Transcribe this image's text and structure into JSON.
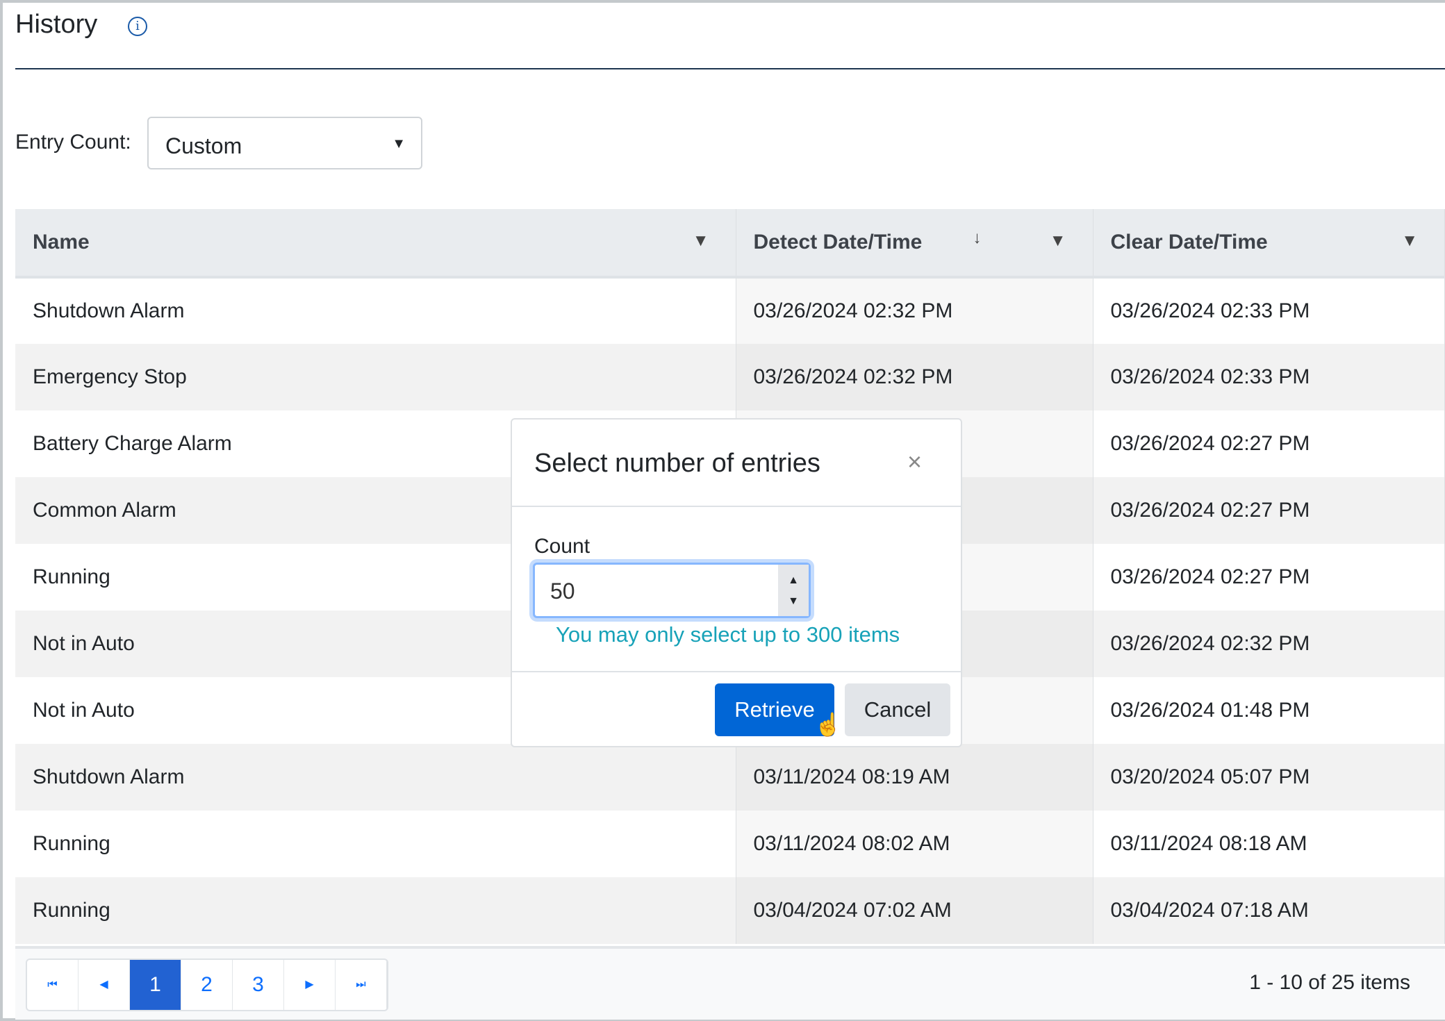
{
  "header": {
    "title": "History",
    "info_icon": "info-circle-icon"
  },
  "entry_count": {
    "label": "Entry Count:",
    "selected": "Custom"
  },
  "table": {
    "columns": [
      "Name",
      "Detect Date/Time",
      "Clear Date/Time"
    ],
    "sorted_column": "Detect Date/Time",
    "sort_direction": "descending",
    "rows": [
      [
        "Shutdown Alarm",
        "03/26/2024 02:32 PM",
        "03/26/2024 02:33 PM"
      ],
      [
        "Emergency Stop",
        "03/26/2024 02:32 PM",
        "03/26/2024 02:33 PM"
      ],
      [
        "Battery Charge Alarm",
        "",
        "03/26/2024 02:27 PM"
      ],
      [
        "Common Alarm",
        "",
        "03/26/2024 02:27 PM"
      ],
      [
        "Running",
        "",
        "03/26/2024 02:27 PM"
      ],
      [
        "Not in Auto",
        "",
        "03/26/2024 02:32 PM"
      ],
      [
        "Not in Auto",
        "",
        "03/26/2024 01:48 PM"
      ],
      [
        "Shutdown Alarm",
        "03/11/2024 08:19 AM",
        "03/20/2024 05:07 PM"
      ],
      [
        "Running",
        "03/11/2024 08:02 AM",
        "03/11/2024 08:18 AM"
      ],
      [
        "Running",
        "03/04/2024 07:02 AM",
        "03/04/2024 07:18 AM"
      ]
    ]
  },
  "pager": {
    "pages": [
      "1",
      "2",
      "3"
    ],
    "current": "1",
    "summary": "1 - 10 of 25 items"
  },
  "modal": {
    "title": "Select number of entries",
    "count_label": "Count",
    "count_value": "50",
    "help": "You may only select up to 300 items",
    "retrieve": "Retrieve",
    "cancel": "Cancel"
  },
  "colors": {
    "primary": "#0166d6",
    "help": "#17a2b8",
    "active_page": "#2262d2"
  }
}
